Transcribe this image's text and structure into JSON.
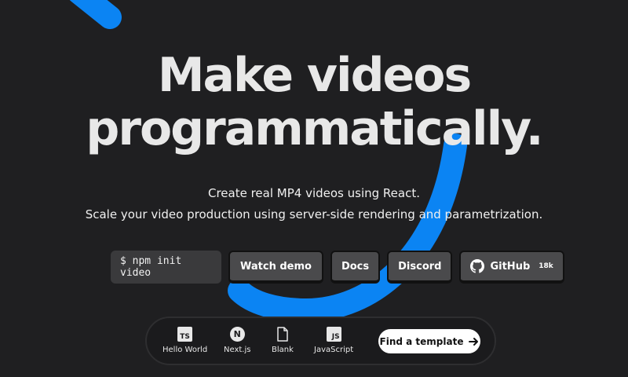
{
  "hero": {
    "line1": "Make videos",
    "line2": "programmatically."
  },
  "subtitle": {
    "line1": "Create real MP4 videos using React.",
    "line2": "Scale your video production using server-side rendering and parametrization."
  },
  "actions": {
    "command": "$ npm init video",
    "watch_demo": "Watch demo",
    "docs": "Docs",
    "discord": "Discord",
    "github": "GitHub",
    "github_stars": "18k"
  },
  "templates": {
    "items": [
      {
        "label": "Hello World",
        "icon": "typescript-icon",
        "icon_text": "TS"
      },
      {
        "label": "Next.js",
        "icon": "nextjs-icon",
        "icon_text": "N"
      },
      {
        "label": "Blank",
        "icon": "file-icon",
        "icon_text": ""
      },
      {
        "label": "JavaScript",
        "icon": "javascript-icon",
        "icon_text": "JS"
      }
    ],
    "find_label": "Find a template"
  },
  "colors": {
    "background": "#1f1f21",
    "accent_blue": "#0b84f3",
    "button_bg": "#4a4a4c",
    "title_text": "#e8e8e8"
  }
}
